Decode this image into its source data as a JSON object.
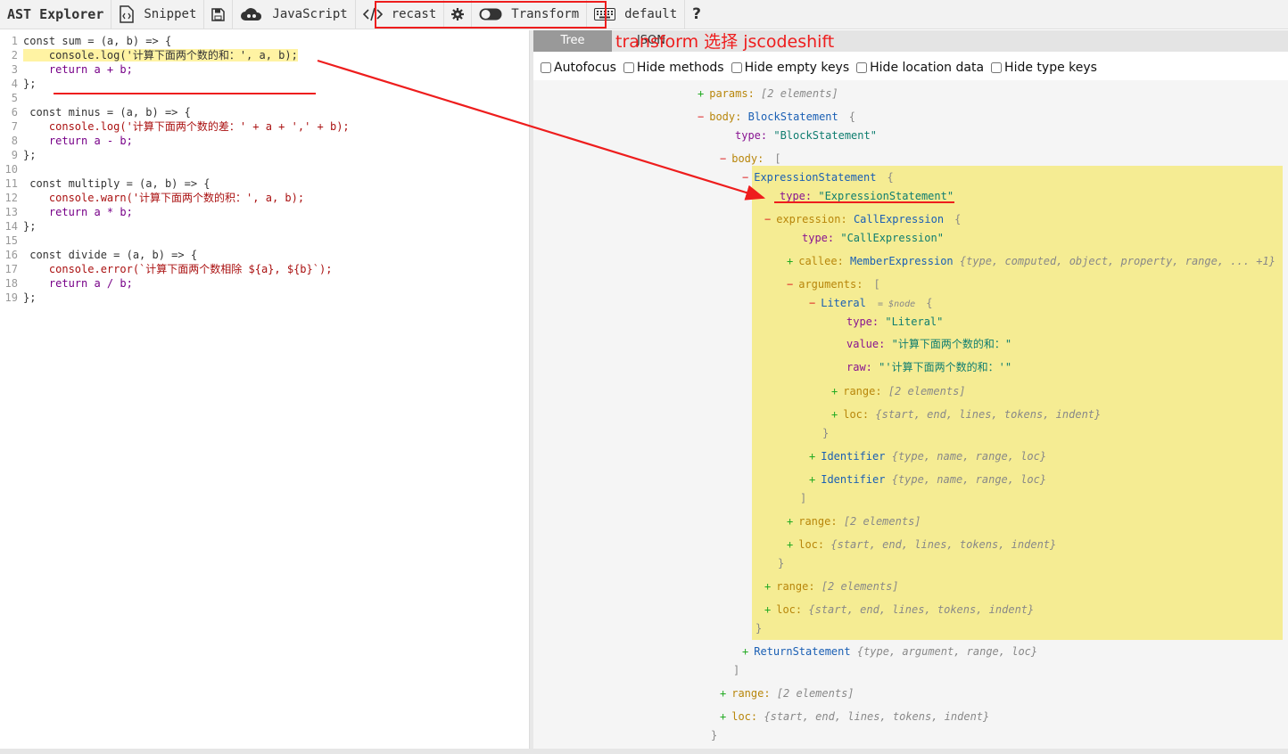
{
  "toolbar": {
    "logo": "AST Explorer",
    "snippet": "Snippet",
    "language": "JavaScript",
    "parser": "recast",
    "transform": "Transform",
    "keymap": "default",
    "help": "?"
  },
  "annotation": "transform 选择 jscodeshift",
  "tabs": {
    "tree": "Tree",
    "json": "JSON"
  },
  "options": {
    "autofocus": "Autofocus",
    "hide_methods": "Hide methods",
    "hide_empty_keys": "Hide empty keys",
    "hide_location_data": "Hide location data",
    "hide_type_keys": "Hide type keys"
  },
  "code": {
    "l1": "const sum = (a, b) => {",
    "l2": "    console.log('计算下面两个数的和：', a, b);",
    "l3": "    return a + b;",
    "l4": "};",
    "l6": " const minus = (a, b) => {",
    "l7": "    console.log('计算下面两个数的差：' + a + ',' + b);",
    "l8": "    return a - b;",
    "l9": "};",
    "l11": " const multiply = (a, b) => {",
    "l12": "    console.warn('计算下面两个数的积：', a, b);",
    "l13": "    return a * b;",
    "l14": "};",
    "l16": " const divide = (a, b) => {",
    "l17": "    console.error(`计算下面两个数相除 ${a}, ${b}`);",
    "l18": "    return a / b;",
    "l19": "};"
  },
  "tree": {
    "params_key": "params:",
    "params_val": "[2 elements]",
    "body_key": "body:",
    "body_node": "BlockStatement",
    "type_key": "type:",
    "block_type": "\"BlockStatement\"",
    "body2_key": "body:",
    "expr_node": "ExpressionStatement",
    "expr_type": "\"ExpressionStatement\"",
    "expression_key": "expression:",
    "call_node": "CallExpression",
    "call_type": "\"CallExpression\"",
    "callee_key": "callee:",
    "member_node": "MemberExpression",
    "callee_summary": "{type, computed, object, property, range, ... +1}",
    "arguments_key": "arguments:",
    "literal_node": "Literal",
    "literal_ref": "= $node",
    "literal_type": "\"Literal\"",
    "value_key": "value:",
    "value_val": "\"计算下面两个数的和：\"",
    "raw_key": "raw:",
    "raw_val": "\"'计算下面两个数的和：'\"",
    "range_key": "range:",
    "range_val": "[2 elements]",
    "loc_key": "loc:",
    "loc_val": "{start, end, lines, tokens, indent}",
    "ident_node": "Identifier",
    "ident_summary": "{type, name, range, loc}",
    "return_node": "ReturnStatement",
    "return_summary": "{type, argument, range, loc}"
  },
  "colors": {
    "highlight": "#f5ec93",
    "annotation_red": "#ee1d1d",
    "tree_added": "#22aa22"
  }
}
